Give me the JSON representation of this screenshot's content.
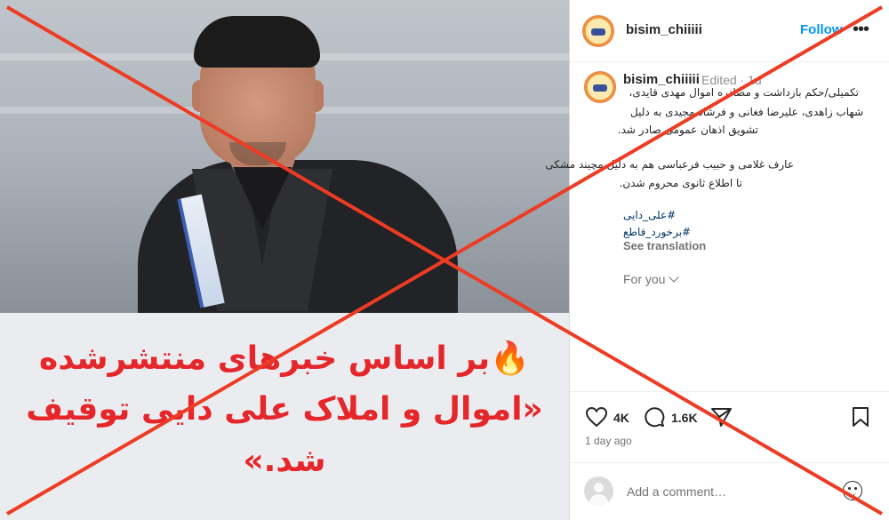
{
  "overlay": {
    "color": "#ee3b24"
  },
  "post_image": {
    "caption_lines": [
      "🔥بر اساس خبرهای منتشرشده",
      "«اموال و املاک علی دایی توقیف",
      "شد.»"
    ],
    "caption_color": "#e5262a"
  },
  "header": {
    "username": "bisim_chiiiii",
    "follow_label": "Follow",
    "more_icon": "more-horizontal-icon"
  },
  "comment": {
    "username": "bisim_chiiiii",
    "edited": "Edited · 1d",
    "lines": [
      "تکمیلی/حکم بازداشت و مصادره اموال مهدی قایدی،",
      "شهاب زاهدی، علیرضا فغانی و فرشاد مجیدی به دلیل",
      "تشویق اذهان عمومی صادر شد.",
      "عارف غلامی و حبیب فرعباسی هم به دلیل مچیند مشکی",
      "تا اطلاع ثانوی محروم شدن."
    ],
    "hashtags": [
      "#علی_دایی",
      "#برخورد_قاطع"
    ],
    "see_translation": "See translation",
    "for_you": "For you"
  },
  "actions": {
    "likes": "4K",
    "comments": "1.6K",
    "time_ago": "1 day ago",
    "link_color": "#0095f6"
  },
  "add_comment": {
    "placeholder": "Add a comment…"
  }
}
